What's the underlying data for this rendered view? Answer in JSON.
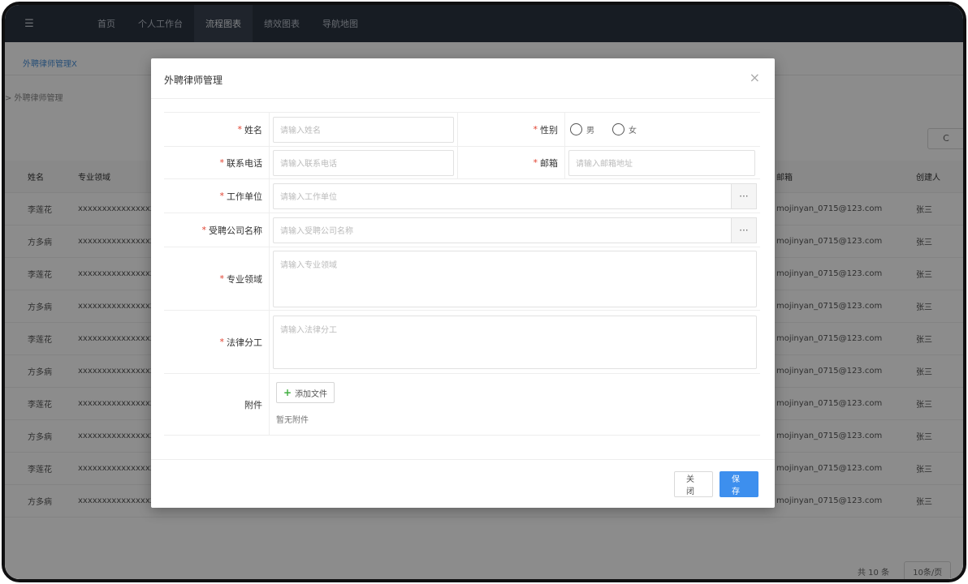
{
  "nav": {
    "menu_icon": "menu-icon",
    "items": [
      "首页",
      "个人工作台",
      "流程图表",
      "绩效图表",
      "导航地图"
    ],
    "active_index": 2
  },
  "page": {
    "tab": "外聘律师管理X",
    "breadcrumb": "> 外聘律师管理",
    "refresh_icon": "C"
  },
  "table": {
    "headers": {
      "name": "姓名",
      "field": "专业领域",
      "email": "邮箱",
      "creator": "创建人"
    },
    "rows": [
      {
        "name": "李莲花",
        "field": "xxxxxxxxxxxxxxxx",
        "email": "mojinyan_0715@123.com",
        "creator": "张三"
      },
      {
        "name": "方多病",
        "field": "xxxxxxxxxxxxxxxx",
        "email": "mojinyan_0715@123.com",
        "creator": "张三"
      },
      {
        "name": "李莲花",
        "field": "xxxxxxxxxxxxxxxx",
        "email": "mojinyan_0715@123.com",
        "creator": "张三"
      },
      {
        "name": "方多病",
        "field": "xxxxxxxxxxxxxxxx",
        "email": "mojinyan_0715@123.com",
        "creator": "张三"
      },
      {
        "name": "李莲花",
        "field": "xxxxxxxxxxxxxxxx",
        "email": "mojinyan_0715@123.com",
        "creator": "张三"
      },
      {
        "name": "方多病",
        "field": "xxxxxxxxxxxxxxxx",
        "email": "mojinyan_0715@123.com",
        "creator": "张三"
      },
      {
        "name": "李莲花",
        "field": "xxxxxxxxxxxxxxxx",
        "email": "mojinyan_0715@123.com",
        "creator": "张三"
      },
      {
        "name": "方多病",
        "field": "xxxxxxxxxxxxxxxx",
        "email": "mojinyan_0715@123.com",
        "creator": "张三"
      },
      {
        "name": "李莲花",
        "field": "xxxxxxxxxxxxxxxx",
        "email": "mojinyan_0715@123.com",
        "creator": "张三"
      },
      {
        "name": "方多病",
        "field": "xxxxxxxxxxxxxxxx",
        "email": "mojinyan_0715@123.com",
        "creator": "张三"
      }
    ],
    "total": "共 10 条",
    "page_size": "10条/页"
  },
  "dialog": {
    "title": "外聘律师管理",
    "close_icon": "×",
    "fields": {
      "name_label": "姓名",
      "name_placeholder": "请输入姓名",
      "gender_label": "性别",
      "gender_male": "男",
      "gender_female": "女",
      "phone_label": "联系电话",
      "phone_placeholder": "请输入联系电话",
      "email_label": "邮箱",
      "email_placeholder": "请输入邮箱地址",
      "workplace_label": "工作单位",
      "workplace_placeholder": "请输入工作单位",
      "company_label": "受聘公司名称",
      "company_placeholder": "请输入受聘公司名称",
      "expertise_label": "专业领域",
      "expertise_placeholder": "请输入专业领域",
      "division_label": "法律分工",
      "division_placeholder": "请输入法律分工",
      "attachment_label": "附件",
      "add_file": "添加文件",
      "no_attachment": "暂无附件"
    },
    "lookup_icon": "···",
    "close_button": "关闭",
    "save_button": "保存"
  }
}
